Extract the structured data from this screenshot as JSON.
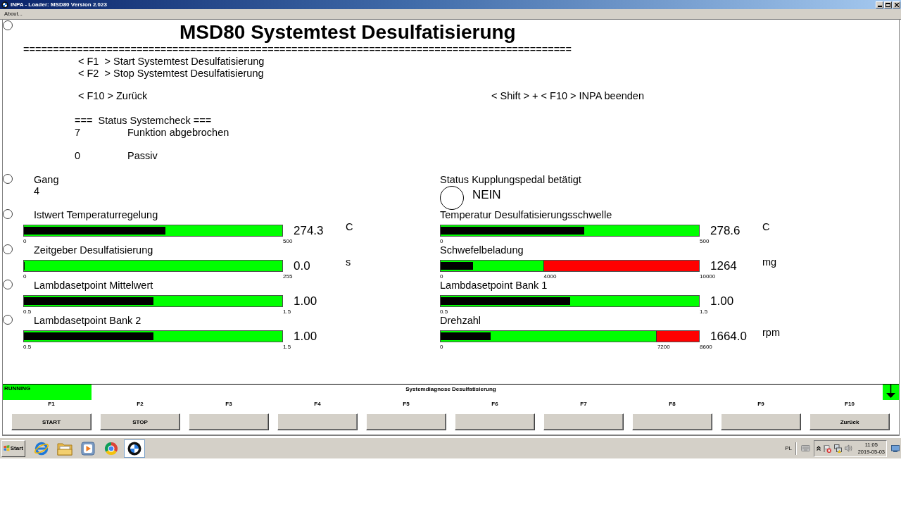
{
  "window": {
    "title": "INPA - Loader: MSD80 Version 2.023"
  },
  "menu": [
    {
      "label": "About..."
    }
  ],
  "header": {
    "selected": false,
    "title": "MSD80 Systemtest Desulfatisierung",
    "divider": "============================================================================================",
    "hints": [
      "< F1  > Start Systemtest Desulfatisierung",
      "< F2  > Stop Systemtest Desulfatisierung"
    ],
    "nav": [
      "< F10 > Zurück",
      "< Shift > + < F10 > INPA beenden"
    ]
  },
  "status_check": {
    "title": "===  Status Systemcheck ===",
    "entries": [
      {
        "code": "7",
        "text": "Funktion abgebrochen"
      },
      {
        "code": "0",
        "text": "Passiv"
      }
    ]
  },
  "rows": [
    {
      "selected": false,
      "left": {
        "kind": "value",
        "label": "Gang",
        "value": "4"
      },
      "right": {
        "kind": "lamp",
        "label": "Status Kupplungspedal betätigt",
        "on": false,
        "value": "NEIN"
      }
    },
    {
      "selected": false,
      "left": {
        "kind": "gauge",
        "label": "Istwert Temperaturregelung",
        "level": 0.549,
        "ticks": [
          "0",
          "500"
        ],
        "zones": [
          {
            "color": "#00ff00"
          }
        ],
        "reading": "274.3",
        "unit": "C"
      },
      "right": {
        "kind": "gauge",
        "label": "Temperatur Desulfatisierungsschwelle",
        "level": 0.557,
        "ticks": [
          "0",
          "500"
        ],
        "zones": [
          {
            "color": "#00ff00"
          }
        ],
        "reading": "278.6",
        "unit": "C"
      }
    },
    {
      "selected": false,
      "left": {
        "kind": "gauge",
        "label": "Zeitgeber Desulfatisierung",
        "level": 0,
        "ticks": [
          "0",
          "255"
        ],
        "zones": [
          {
            "color": "#00ff00"
          }
        ],
        "reading": "0.0",
        "unit": "s"
      },
      "right": {
        "kind": "gauge",
        "label": "Schwefelbeladung",
        "level": 0.126,
        "ticks": [
          "0",
          "4000",
          "10000"
        ],
        "zones": [
          {
            "color": "#00ff00"
          },
          {
            "color": "#ff0000"
          }
        ],
        "reading": "1264",
        "unit": "mg"
      }
    },
    {
      "selected": false,
      "left": {
        "kind": "gauge",
        "label": "Lambdasetpoint Mittelwert",
        "level": 0.5,
        "ticks": [
          "0.5",
          "1.5"
        ],
        "zones": [
          {
            "color": "#00ff00"
          }
        ],
        "reading": "1.00"
      },
      "right": {
        "kind": "gauge",
        "label": "Lambdasetpoint Bank 1",
        "level": 0.5,
        "ticks": [
          "0.5",
          "1.5"
        ],
        "zones": [
          {
            "color": "#00ff00"
          }
        ],
        "reading": "1.00"
      }
    },
    {
      "selected": false,
      "left": {
        "kind": "gauge",
        "label": "Lambdasetpoint Bank 2",
        "level": 0.5,
        "ticks": [
          "0.5",
          "1.5"
        ],
        "zones": [
          {
            "color": "#00ff00"
          }
        ],
        "reading": "1.00"
      },
      "right": {
        "kind": "gauge",
        "label": "Drehzahl",
        "level": 0.193,
        "ticks": [
          "0",
          "7200",
          "8600"
        ],
        "zones": [
          {
            "color": "#00ff00"
          },
          {
            "color": "#ff0000"
          }
        ],
        "reading": "1664.0",
        "unit": "rpm"
      }
    }
  ],
  "status_bar": {
    "state": "RUNNING",
    "title": "Systemdiagnose Desulfatisierung"
  },
  "function_keys": [
    {
      "key": "F1",
      "label": "START"
    },
    {
      "key": "F2",
      "label": "STOP"
    },
    {
      "key": "F3"
    },
    {
      "key": "F4"
    },
    {
      "key": "F5"
    },
    {
      "key": "F6"
    },
    {
      "key": "F7"
    },
    {
      "key": "F8"
    },
    {
      "key": "F9"
    },
    {
      "key": "F10",
      "label": "Zurück"
    }
  ],
  "taskbar": {
    "start": "Start",
    "apps": [
      {
        "kind": "globe",
        "selected": false
      },
      {
        "kind": "folder",
        "selected": false
      },
      {
        "kind": "player",
        "selected": false
      },
      {
        "kind": "wheel",
        "selected": false
      },
      {
        "kind": "roundel",
        "selected": true
      }
    ],
    "language": "PL",
    "time": "11:05",
    "date": "2019-05-03"
  }
}
